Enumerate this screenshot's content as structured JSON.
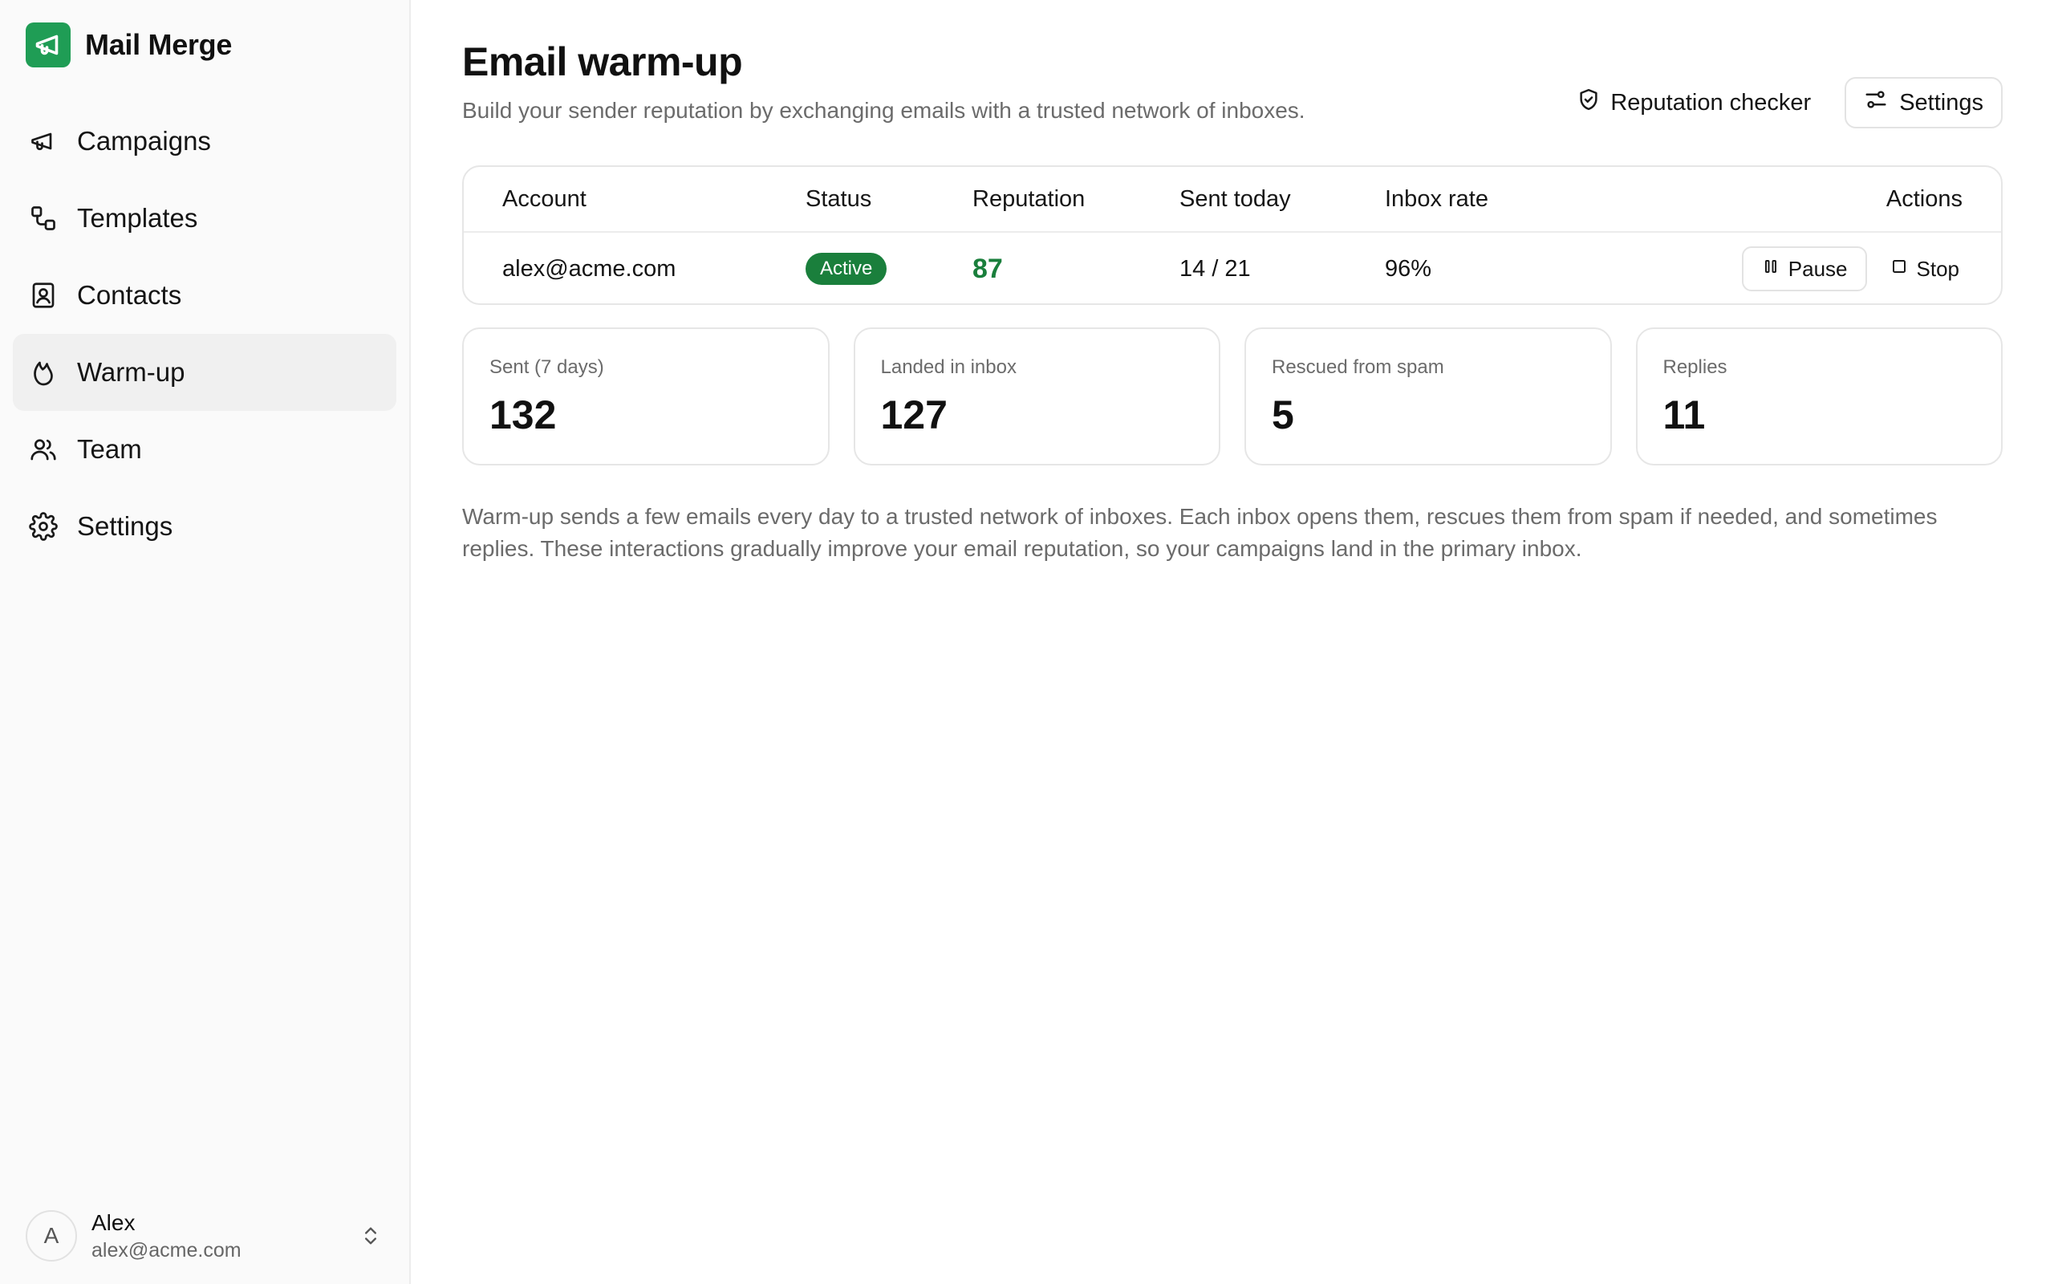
{
  "app": {
    "name": "Mail Merge",
    "brand_color": "#1f9d55"
  },
  "sidebar": {
    "items": [
      {
        "label": "Campaigns",
        "icon": "megaphone-icon"
      },
      {
        "label": "Templates",
        "icon": "templates-icon"
      },
      {
        "label": "Contacts",
        "icon": "contact-book-icon"
      },
      {
        "label": "Warm-up",
        "icon": "flame-icon",
        "active": true
      },
      {
        "label": "Team",
        "icon": "users-icon"
      },
      {
        "label": "Settings",
        "icon": "gear-icon"
      }
    ],
    "user": {
      "initial": "A",
      "name": "Alex",
      "email": "alex@acme.com"
    }
  },
  "page": {
    "title": "Email warm-up",
    "subtitle": "Build your sender reputation by exchanging emails with a trusted network of inboxes.",
    "actions": {
      "reputation_checker": "Reputation checker",
      "settings": "Settings"
    }
  },
  "table": {
    "headers": {
      "account": "Account",
      "status": "Status",
      "reputation": "Reputation",
      "sent_today": "Sent today",
      "inbox_rate": "Inbox rate",
      "actions": "Actions"
    },
    "row": {
      "account": "alex@acme.com",
      "status": "Active",
      "reputation": "87",
      "sent_today": "14 / 21",
      "inbox_rate": "96%",
      "pause": "Pause",
      "stop": "Stop"
    },
    "status_color": "#1a7f3c"
  },
  "stats": [
    {
      "label": "Sent (7 days)",
      "value": "132"
    },
    {
      "label": "Landed in inbox",
      "value": "127"
    },
    {
      "label": "Rescued from spam",
      "value": "5"
    },
    {
      "label": "Replies",
      "value": "11"
    }
  ],
  "description": "Warm-up sends a few emails every day to a trusted network of inboxes. Each inbox opens them, rescues them from spam if needed, and sometimes replies. These interactions gradually improve your email reputation, so your campaigns land in the primary inbox."
}
